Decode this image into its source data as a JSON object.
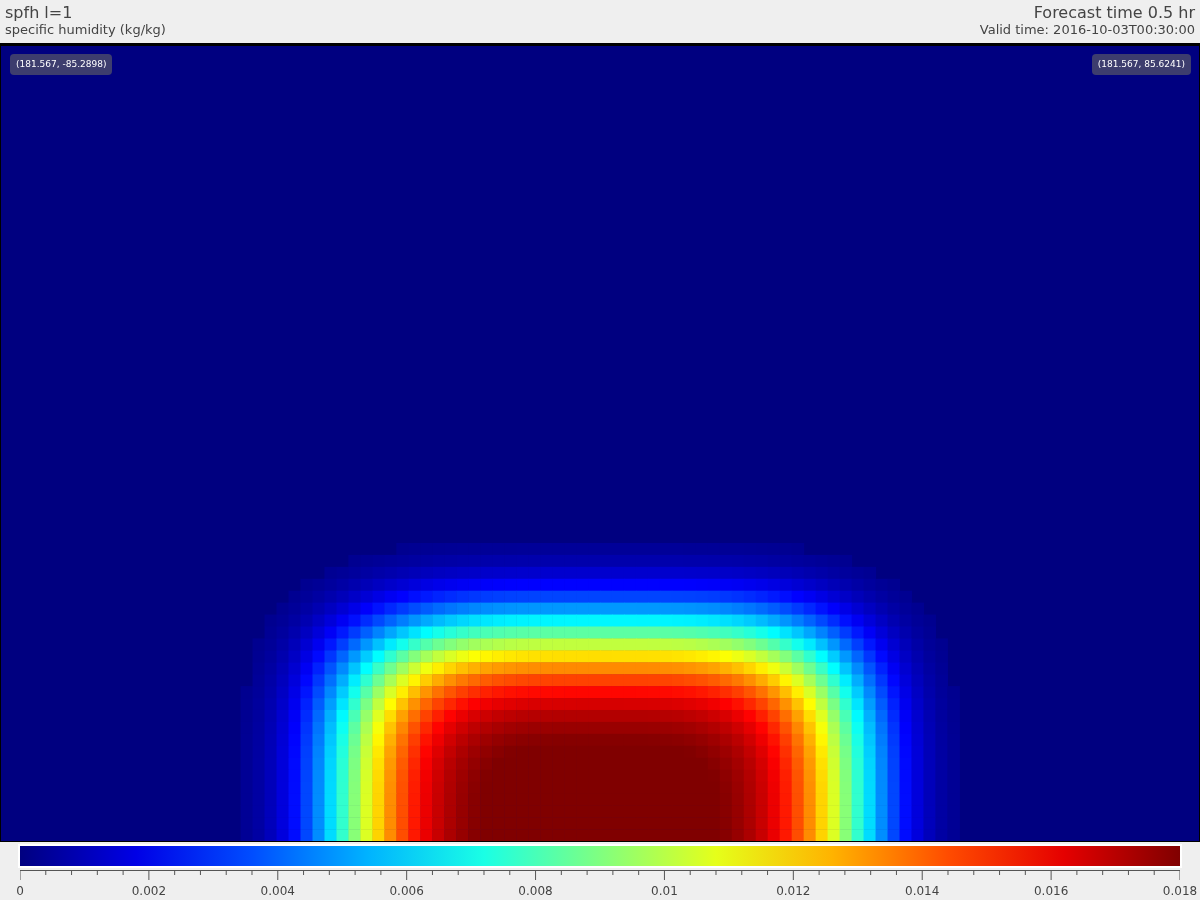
{
  "header": {
    "title": "spfh l=1",
    "subtitle": "specific humidity (kg/kg)",
    "forecast": "Forecast time 0.5 hr",
    "valid_time": "Valid time: 2016-10-03T00:30:00"
  },
  "corner_labels": [
    {
      "text": "(181.567, -85.2898)"
    },
    {
      "text": "(181.567, 85.6241)"
    }
  ],
  "colorbar": {
    "ticks": [
      "0",
      "0.002",
      "0.004",
      "0.006",
      "0.008",
      "0.01",
      "0.012",
      "0.014",
      "0.016",
      "0.018"
    ]
  }
}
